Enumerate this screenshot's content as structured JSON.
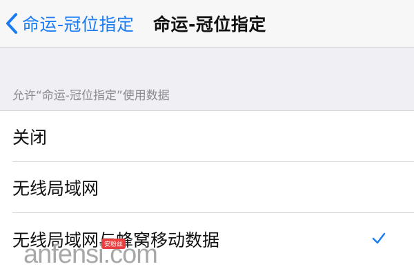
{
  "nav": {
    "back_label": "命运-冠位指定",
    "title": "命运-冠位指定",
    "back_icon": "chevron-left-icon"
  },
  "section": {
    "header": "允许“命运-冠位指定”使用数据"
  },
  "options": [
    {
      "label": "关闭",
      "selected": false
    },
    {
      "label": "无线局域网",
      "selected": false
    },
    {
      "label": "无线局域网与蜂窝移动数据",
      "selected": true
    }
  ],
  "checkmark_icon": "checkmark-icon",
  "watermark": {
    "text": "anfensi.com",
    "badge": "安粉丝"
  },
  "colors": {
    "accent": "#1a7cf5",
    "background": "#efeff4",
    "separator": "#d6d6da",
    "section_text": "#8a8a8f"
  }
}
